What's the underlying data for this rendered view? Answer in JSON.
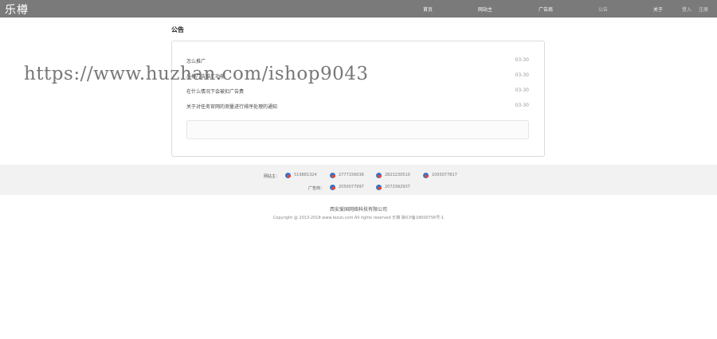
{
  "header": {
    "logo": "乐樽",
    "nav": [
      "首页",
      "网站主",
      "广告商",
      "公告",
      "关于"
    ],
    "login": "登入",
    "register": "注册"
  },
  "main": {
    "title": "公告",
    "news": [
      {
        "title": "怎么推广",
        "date": "03-30"
      },
      {
        "title": "乐樽广告推广功能",
        "date": "03-30"
      },
      {
        "title": "在什么情况下会被扣广告费",
        "date": "03-30"
      },
      {
        "title": "关于对任务官网的测量进行排序处理的通知",
        "date": "03-30"
      }
    ]
  },
  "watermark": "https://www.huzhan.com/ishop9043",
  "footer": {
    "webmaster_label": "网站主：",
    "advertiser_label": "广告商：",
    "webmaster_qq": [
      "519881324",
      "2777156036",
      "2823230510",
      "1003077817"
    ],
    "advertiser_qq": [
      "2050077997",
      "2072992937"
    ],
    "company": "西安爱国网络科技有限公司",
    "copyright": "Copyright @ 2013-2018 www.lezun.com All rights reserved  乐樽  陕ICP备18000756号-1"
  }
}
